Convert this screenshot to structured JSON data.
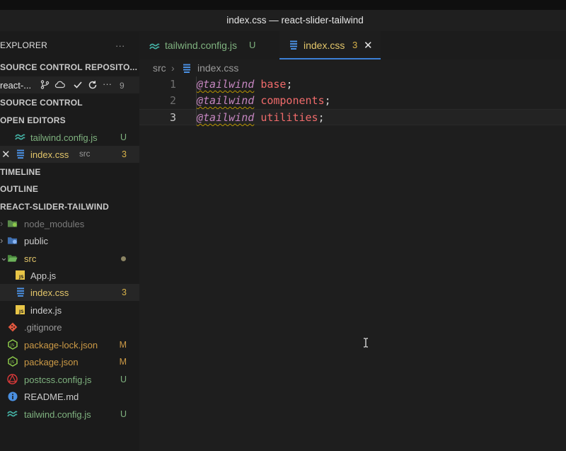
{
  "window": {
    "title": "index.css — react-slider-tailwind"
  },
  "sidebar": {
    "explorer_label": "EXPLORER",
    "more_label": "···",
    "sections": {
      "source_control_repositories": "SOURCE CONTROL REPOSITO...",
      "source_control": "SOURCE CONTROL",
      "open_editors": "OPEN EDITORS",
      "timeline": "TIMELINE",
      "outline": "OUTLINE",
      "project": "REACT-SLIDER-TAILWIND"
    },
    "repo": {
      "name": "react-...",
      "changes": "9"
    },
    "open_editors": [
      {
        "name": "tailwind.config.js",
        "desc": "",
        "badge": "U"
      },
      {
        "name": "index.css",
        "desc": "src",
        "badge": "3"
      }
    ],
    "tree": [
      {
        "name": "node_modules",
        "badge": ""
      },
      {
        "name": "public",
        "badge": ""
      },
      {
        "name": "src",
        "badge": ""
      },
      {
        "name": "App.js",
        "badge": ""
      },
      {
        "name": "index.css",
        "badge": "3"
      },
      {
        "name": "index.js",
        "badge": ""
      },
      {
        "name": ".gitignore",
        "badge": ""
      },
      {
        "name": "package-lock.json",
        "badge": "M"
      },
      {
        "name": "package.json",
        "badge": "M"
      },
      {
        "name": "postcss.config.js",
        "badge": "U"
      },
      {
        "name": "README.md",
        "badge": ""
      },
      {
        "name": "tailwind.config.js",
        "badge": "U"
      }
    ]
  },
  "tabs": [
    {
      "label": "tailwind.config.js",
      "badge": "U"
    },
    {
      "label": "index.css",
      "badge": "3"
    }
  ],
  "breadcrumb": {
    "folder": "src",
    "file": "index.css"
  },
  "editor": {
    "lines": [
      {
        "num": "1",
        "directive": "@tailwind",
        "value": "base",
        "end": ";"
      },
      {
        "num": "2",
        "directive": "@tailwind",
        "value": "components",
        "end": ";"
      },
      {
        "num": "3",
        "directive": "@tailwind",
        "value": "utilities",
        "end": ";"
      }
    ]
  },
  "colors": {
    "accent": "#3c7fd6",
    "untracked": "#7fb27f",
    "modified": "#cc9a46",
    "problems": "#d9b34a",
    "css_icon": "#4a8fe0",
    "js_icon": "#e8c547",
    "tailwind_icon": "#44b1a4"
  }
}
